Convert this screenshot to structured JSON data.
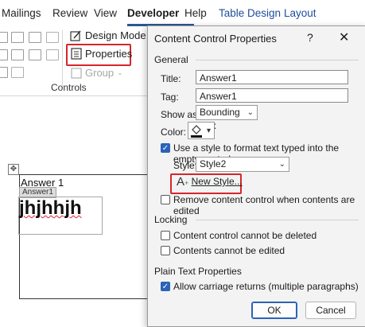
{
  "ribbon": {
    "tabs": [
      "Mailings",
      "Review",
      "View",
      "Developer",
      "Help",
      "Table Design",
      "Layout"
    ],
    "design_mode_label": "Design Mode",
    "properties_label": "Properties",
    "group_label": "Group",
    "group_name": "Controls"
  },
  "document": {
    "heading": "Answer 1",
    "control_tag": "Answer1",
    "control_text": "jhjhhjh"
  },
  "dialog": {
    "title": "Content Control Properties",
    "help": "?",
    "close": "✕",
    "general_label": "General",
    "title_label": "Title:",
    "title_value": "Answer1",
    "tag_label": "Tag:",
    "tag_value": "Answer1",
    "show_as_label": "Show as:",
    "show_as_value": "Bounding Box",
    "color_label": "Color:",
    "use_style_label": "Use a style to format text typed into the empty control",
    "style_label": "Style:",
    "style_value": "Style2",
    "new_style_label": "New Style...",
    "remove_cc_label": "Remove content control when contents are edited",
    "locking_label": "Locking",
    "lock_delete_label": "Content control cannot be deleted",
    "lock_edit_label": "Contents cannot be edited",
    "plain_text_label": "Plain Text Properties",
    "allow_returns_label": "Allow carriage returns (multiple paragraphs)",
    "ok_label": "OK",
    "cancel_label": "Cancel"
  },
  "colors": {
    "accent": "#2b63b8",
    "highlight_box": "#d6262c"
  }
}
